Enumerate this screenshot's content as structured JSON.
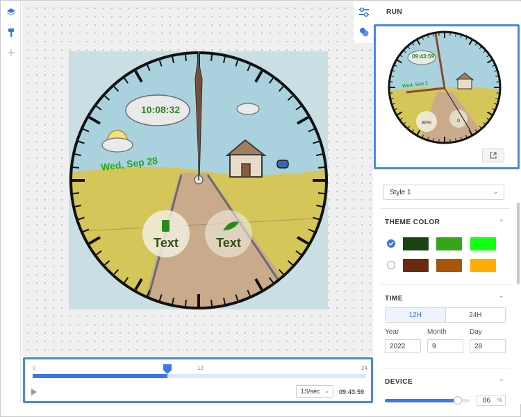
{
  "run_title": "RUN",
  "canvas": {
    "face": {
      "digital_time": "10:08:32",
      "date": "Wed, Sep 28",
      "complication_left": "Text",
      "complication_right": "Text"
    }
  },
  "preview": {
    "digital_time": "09:43:59",
    "battery_value": "86%",
    "steps_value": "0",
    "date_snippet": "Wed, Sep 2"
  },
  "timeline": {
    "start_label": "0",
    "mid_label": "12",
    "end_label": "24",
    "progress": 0.405,
    "speed": "1S/sec",
    "current_time": "09:43:59"
  },
  "style": {
    "selected": "Style 1"
  },
  "theme_color": {
    "title": "THEME COLOR",
    "rows": [
      {
        "selected": true,
        "colors": [
          "#1b4311",
          "#36a51a",
          "#12ff11"
        ]
      },
      {
        "selected": false,
        "colors": [
          "#6b2a10",
          "#a8560c",
          "#ffae00"
        ]
      }
    ]
  },
  "time_section": {
    "title": "TIME",
    "format_12": "12H",
    "format_24": "24H",
    "year_label": "Year",
    "month_label": "Month",
    "day_label": "Day",
    "year": "2022",
    "month": "9",
    "day": "28"
  },
  "device": {
    "title": "DEVICE",
    "value": "86",
    "unit": "%",
    "fraction": 0.86
  },
  "icons": {
    "rail": [
      "layers-icon",
      "brush-icon",
      "plus-icon"
    ],
    "side": [
      "sliders-icon",
      "palette-icon"
    ],
    "preview": "open-external-icon"
  },
  "accent": "#3b78e7"
}
